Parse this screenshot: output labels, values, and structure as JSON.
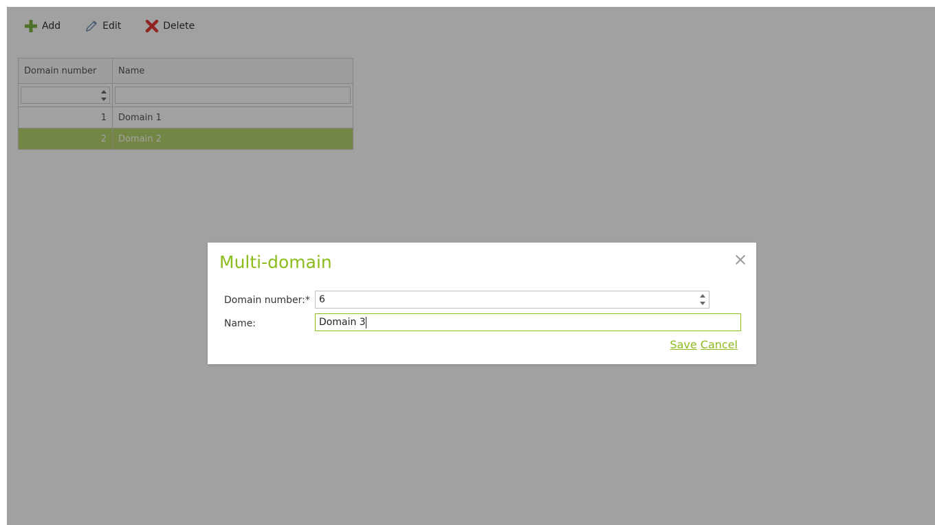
{
  "toolbar": {
    "add_label": "Add",
    "edit_label": "Edit",
    "delete_label": "Delete"
  },
  "grid": {
    "columns": [
      "Domain number",
      "Name"
    ],
    "rows": [
      {
        "number": "1",
        "name": "Domain 1"
      },
      {
        "number": "2",
        "name": "Domain 2",
        "selected": true
      }
    ]
  },
  "dialog": {
    "title": "Multi-domain",
    "fields": {
      "domain_number_label": "Domain number:*",
      "domain_number_value": "6",
      "name_label": "Name:",
      "name_value": "Domain 3"
    },
    "save_label": "Save",
    "cancel_label": "Cancel"
  },
  "icons": {
    "add": "plus-icon",
    "edit": "pencil-icon",
    "delete": "x-icon",
    "close": "close-icon",
    "spinner": "spinner-arrows-icon"
  },
  "colors": {
    "accent": "#8bbb1d",
    "selected_row": "#b6d56e",
    "delete_icon": "#e53935",
    "add_icon": "#7cb342"
  }
}
